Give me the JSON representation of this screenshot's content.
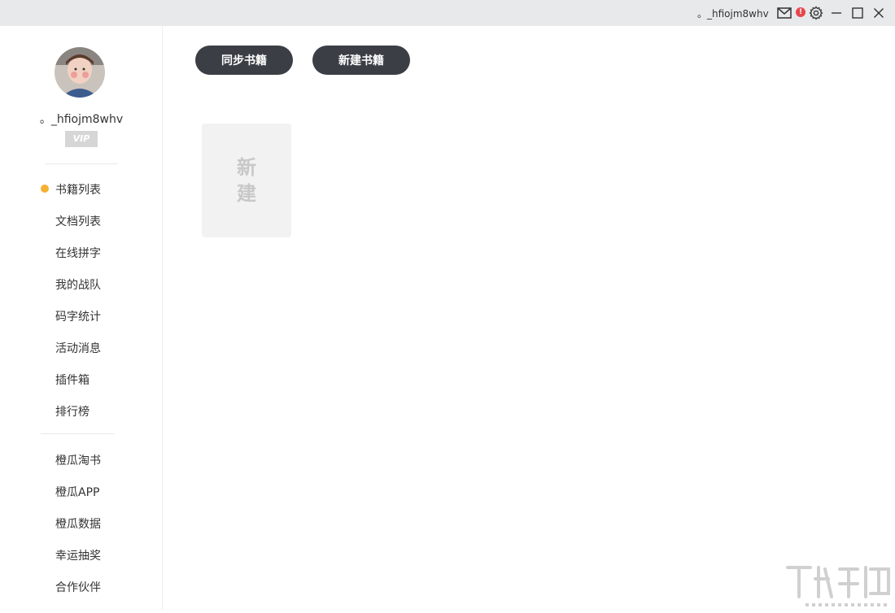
{
  "titlebar": {
    "username": "。_hfiojm8whv",
    "badge": "!"
  },
  "sidebar": {
    "username": "。_hfiojm8whv",
    "vip_label": "VIP",
    "nav_primary": [
      {
        "label": "书籍列表",
        "active": true
      },
      {
        "label": "文档列表",
        "active": false
      },
      {
        "label": "在线拼字",
        "active": false
      },
      {
        "label": "我的战队",
        "active": false
      },
      {
        "label": "码字统计",
        "active": false
      },
      {
        "label": "活动消息",
        "active": false
      },
      {
        "label": "插件箱",
        "active": false
      },
      {
        "label": "排行榜",
        "active": false
      }
    ],
    "nav_secondary": [
      {
        "label": "橙瓜淘书"
      },
      {
        "label": "橙瓜APP"
      },
      {
        "label": "橙瓜数据"
      },
      {
        "label": "幸运抽奖"
      },
      {
        "label": "合作伙伴"
      }
    ]
  },
  "main": {
    "sync_button": "同步书籍",
    "new_book_button": "新建书籍",
    "new_card_label": "新建"
  },
  "colors": {
    "titlebar_bg": "#e8e9eb",
    "button_bg": "#3b3f45",
    "active_dot": "#f5b132",
    "badge": "#e5484d"
  }
}
